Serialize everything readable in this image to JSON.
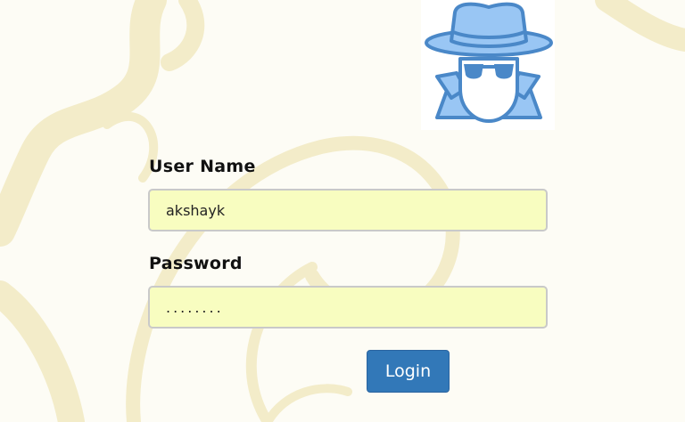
{
  "login_form": {
    "username_label": "User Name",
    "username_value": "akshayk",
    "password_label": "Password",
    "password_value": "........",
    "login_button": "Login"
  },
  "logo": {
    "icon": "spy-detective-icon"
  },
  "colors": {
    "background": "#fdfcf5",
    "swirl": "#f3ecc9",
    "input_background": "#f8fdc0",
    "button": "#3278b8",
    "logo_fill": "#99c6f4",
    "logo_stroke": "#4a88c8"
  }
}
